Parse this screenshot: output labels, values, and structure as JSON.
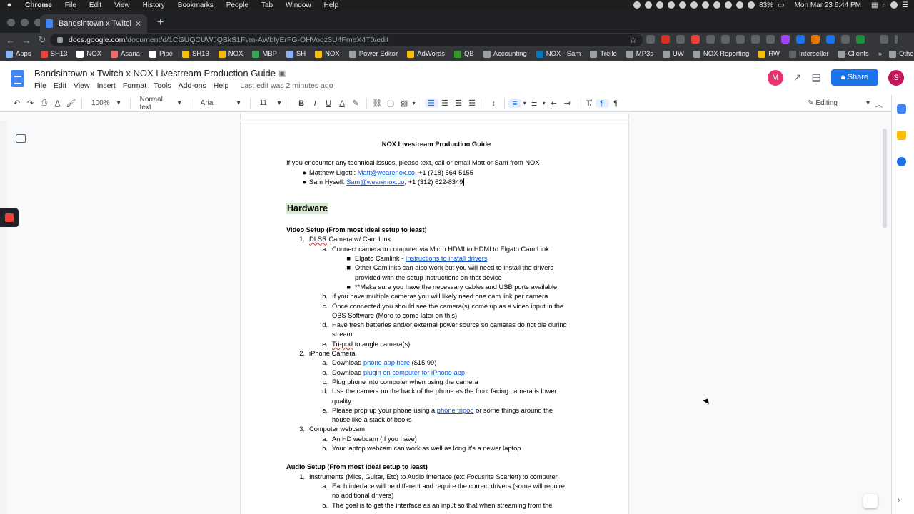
{
  "menubar": {
    "app": "Chrome",
    "items": [
      "File",
      "Edit",
      "View",
      "History",
      "Bookmarks",
      "People",
      "Tab",
      "Window",
      "Help"
    ],
    "battery": "83%",
    "clock": "Mon Mar 23  6:44 PM"
  },
  "browser": {
    "tab_title": "Bandsintown x Twitch x NOX Liv",
    "url_domain": "docs.google.com",
    "url_path": "/document/d/1CGUQCUWJQBkS1Fvm-AWbIyErFG-OHVoqz3U4FmeX4T0/edit",
    "bookmarks": [
      "Apps",
      "SH13",
      "NOX",
      "Asana",
      "Pipe",
      "SH13",
      "NOX",
      "MBP",
      "SH",
      "NOX",
      "Power Editor",
      "AdWords",
      "QB",
      "Accounting",
      "NOX - Sam",
      "Trello",
      "MP3s",
      "UW",
      "NOX Reporting",
      "RW",
      "Interseller",
      "Clients"
    ],
    "other_bookmarks": "Other Bookmarks"
  },
  "docs": {
    "title": "Bandsintown x Twitch x NOX Livestream Production Guide",
    "menus": [
      "File",
      "Edit",
      "View",
      "Insert",
      "Format",
      "Tools",
      "Add-ons",
      "Help"
    ],
    "last_edit": "Last edit was 2 minutes ago",
    "share_label": "Share",
    "avatar_initial": "S",
    "collab_initial": "M",
    "toolbar": {
      "zoom": "100%",
      "style": "Normal text",
      "font": "Arial",
      "size": "11",
      "mode": "Editing"
    }
  },
  "document": {
    "heading": "NOX Livestream Production Guide",
    "intro": "If you encounter any technical issues, please text, call or email Matt or Sam from NOX",
    "contacts": [
      {
        "name": "Matthew Ligotti: ",
        "email": "Matt@wearenox.co",
        "phone": ", +1 (718) 564-5155"
      },
      {
        "name": "Sam Hysell: ",
        "email": "Sam@wearenox.co",
        "phone": ", +1 (312) 622-8349"
      }
    ],
    "hardware": "Hardware",
    "video_setup": "Video Setup (From most ideal setup to least)",
    "dslr": {
      "num": "1.",
      "word": "DLSR",
      "rest": " Camera w/ Cam Link",
      "a": "Connect camera to computer via Micro HDMI to HDMI to Elgato Cam Link",
      "a_bullets": {
        "b1_prefix": "Elgato Camlink - ",
        "b1_link": "Instructions to install drivers",
        "b2_line1": "Other Camlinks can also work but you will need to install the drivers",
        "b2_line2": "provided with the setup instructions on that device",
        "b3": "**Make sure you have the necessary cables and USB ports available"
      },
      "b": "If you have multiple cameras you will likely need one cam link per camera",
      "c_line1": "Once connected you should see the camera(s) come up as a video input in the",
      "c_line2": "OBS Software (More to come later on this)",
      "d_line1": "Have fresh batteries and/or external power source so cameras do not die during",
      "d_line2": "stream",
      "e_word": "Tri-pod",
      "e_rest": " to angle camera(s)"
    },
    "iphone": {
      "num": "2.",
      "title": "iPhone Camera",
      "a_prefix": "Download ",
      "a_link": "phone app here",
      "a_suffix": " ($15.99)",
      "b_prefix": "Download ",
      "b_link": "plugin on computer for iPhone app",
      "c": "Plug phone into computer when using the camera",
      "d_line1": "Use the camera on the back of the phone as the front facing camera is lower",
      "d_line2": "quality",
      "e_prefix": "Please prop up your phone using a ",
      "e_link": "phone tripod",
      "e_suffix": " or some things around the",
      "e_line2": "house like a stack of books"
    },
    "webcam": {
      "num": "3.",
      "title": "Computer webcam",
      "a": "An HD webcam (If you have)",
      "b": "Your laptop webcam can work as well as long it's a newer laptop"
    },
    "audio_setup": "Audio Setup (From most ideal setup to least)",
    "audio": {
      "num": "1.",
      "title": "Instruments (Mics, Guitar, Etc) to Audio Interface (ex: Focusrite Scarlett) to computer",
      "a_line1": "Each interface will be different and require the correct drivers (some will require",
      "a_line2": "no additional drivers)",
      "b_line1": "The goal is to get the interface as an input so that when streaming from the"
    }
  }
}
